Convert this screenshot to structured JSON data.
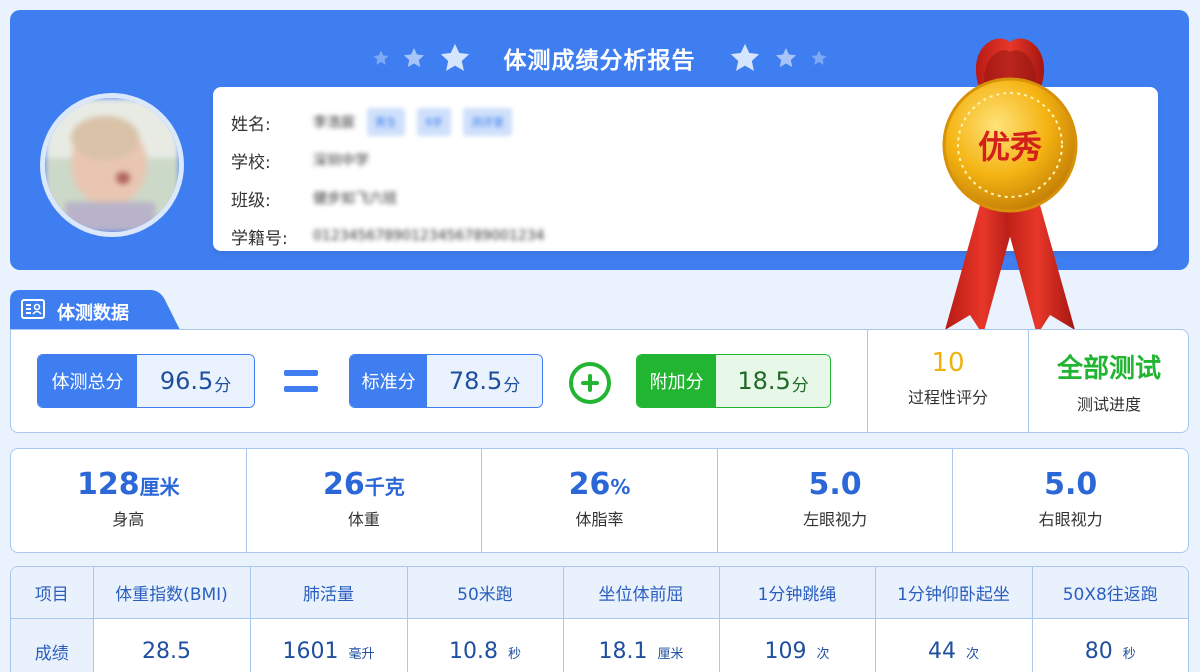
{
  "header": {
    "title": "体测成绩分析报告",
    "medal_text": "优秀"
  },
  "student": {
    "name_label": "姓名:",
    "name_value": "李浩宸",
    "tags": [
      "男生",
      "9岁",
      "测评里"
    ],
    "school_label": "学校:",
    "school_value": "深圳中学",
    "class_label": "班级:",
    "class_value": "健步如飞六班",
    "id_label": "学籍号:",
    "id_value": "01234567890123456789001234"
  },
  "section": {
    "title": "体测数据"
  },
  "scores": {
    "total_label": "体测总分",
    "total_value": "96.5",
    "standard_label": "标准分",
    "standard_value": "78.5",
    "bonus_label": "附加分",
    "bonus_value": "18.5",
    "unit": "分",
    "process_value": "10",
    "process_label": "过程性评分",
    "progress_value": "全部测试",
    "progress_label": "测试进度"
  },
  "metrics": [
    {
      "value": "128",
      "unit": "厘米",
      "label": "身高"
    },
    {
      "value": "26",
      "unit": "千克",
      "label": "体重"
    },
    {
      "value": "26",
      "unit": "%",
      "label": "体脂率"
    },
    {
      "value": "5.0",
      "unit": "",
      "label": "左眼视力"
    },
    {
      "value": "5.0",
      "unit": "",
      "label": "右眼视力"
    }
  ],
  "table": {
    "headers": [
      "项目",
      "体重指数(BMI)",
      "肺活量",
      "50米跑",
      "坐位体前屈",
      "1分钟跳绳",
      "1分钟仰卧起坐",
      "50X8往返跑"
    ],
    "row_label": "成绩",
    "values": [
      "28.5",
      "1601",
      "10.8",
      "18.1",
      "109",
      "44",
      "80"
    ],
    "units": [
      "",
      "毫升",
      "秒",
      "厘米",
      "次",
      "次",
      "秒"
    ]
  },
  "colors": {
    "header_blue": "#3f7ef0",
    "green": "#21b531",
    "gold": "#f2b410",
    "ribbon_red": "#d9261c"
  }
}
